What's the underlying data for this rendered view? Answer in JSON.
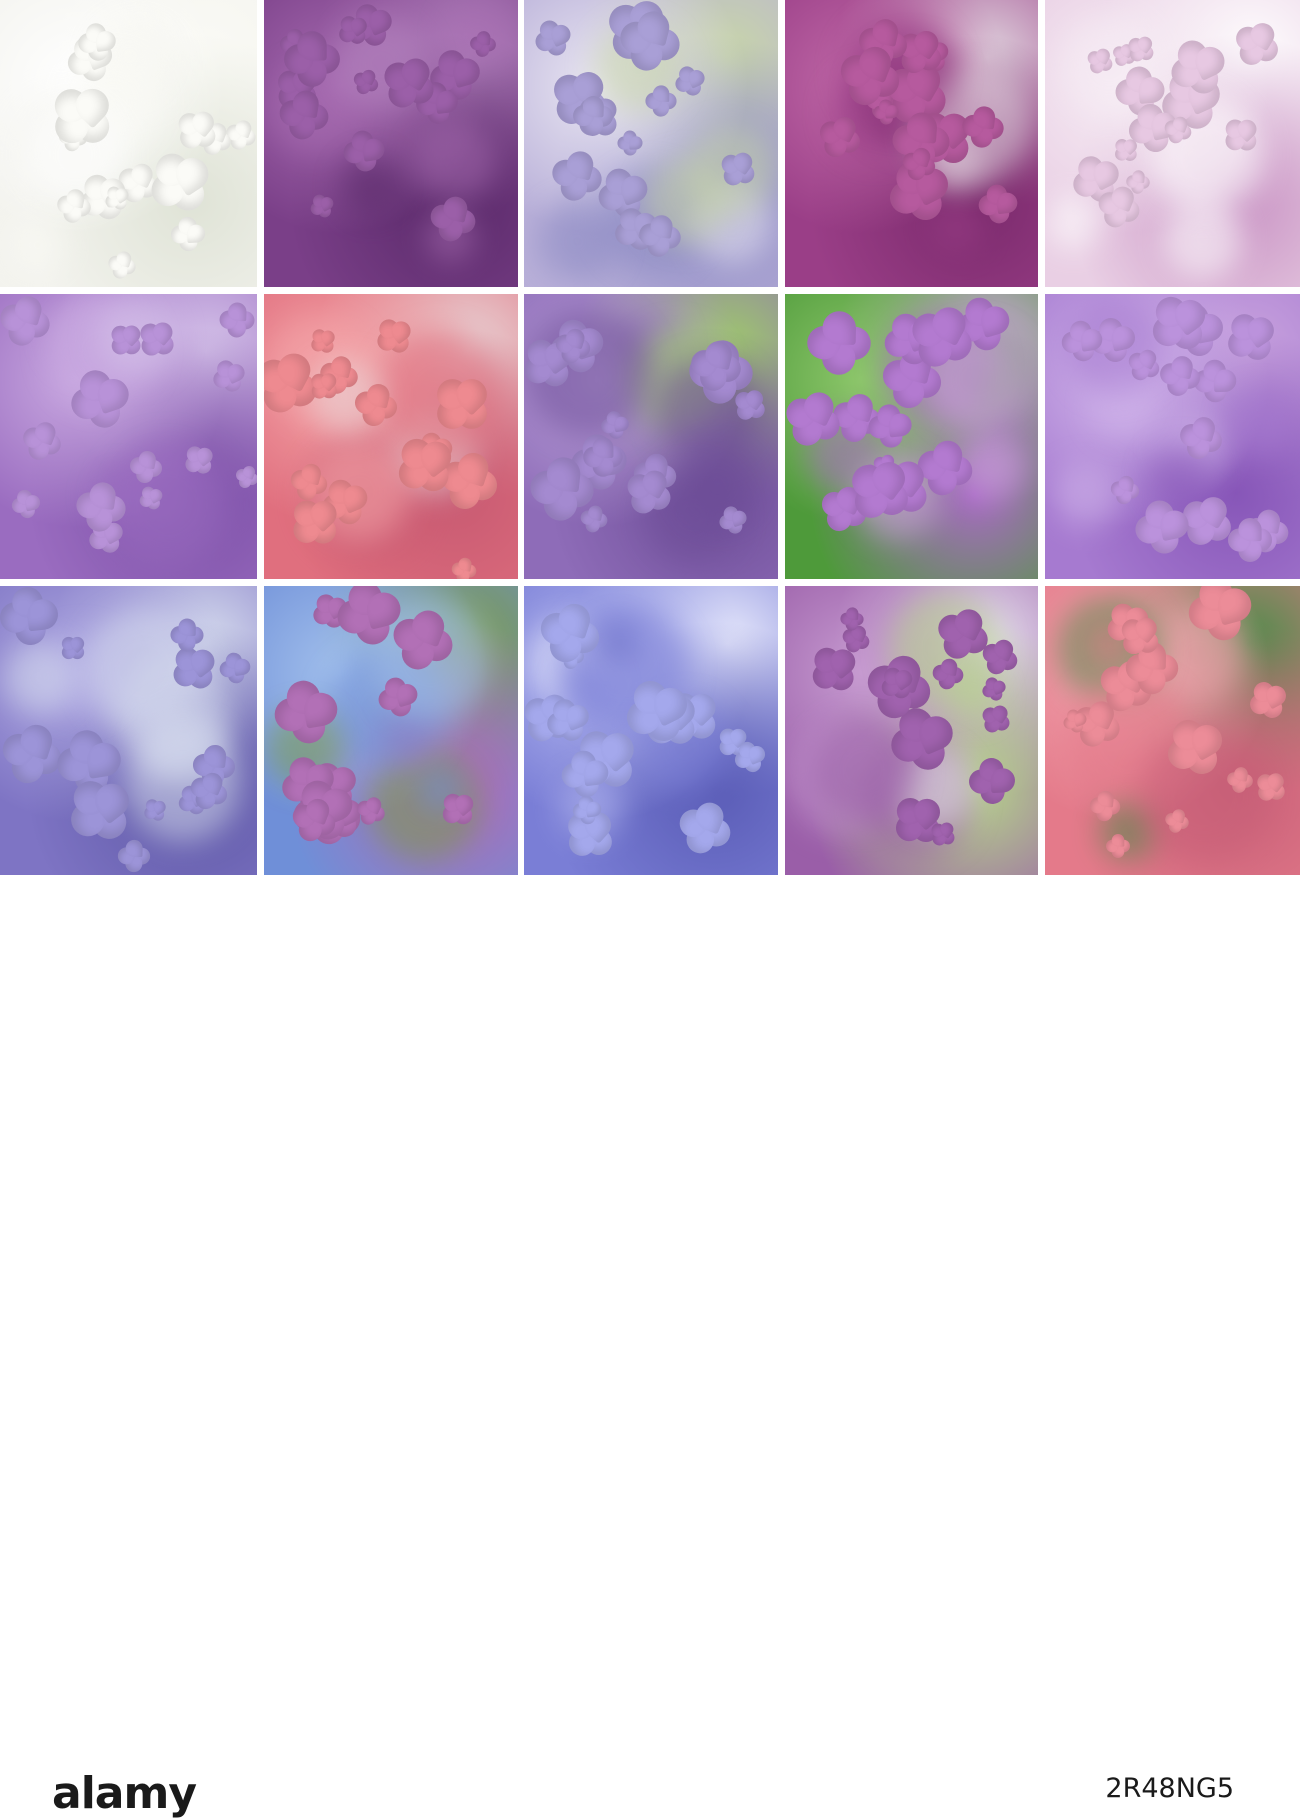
{
  "collage": {
    "tiles": [
      {
        "id": "white-lilac",
        "colors": [
          "#f3f3ee",
          "#ffffff",
          "#dfe3d6",
          "#fafaf5"
        ],
        "petal": "#fbfbf7"
      },
      {
        "id": "purple-lilac-buds",
        "colors": [
          "#7a3f88",
          "#a66bb0",
          "#5a2a6a",
          "#b586c0"
        ],
        "petal": "#9b5fa8"
      },
      {
        "id": "lavender-lilac-sunlight",
        "colors": [
          "#b8afd8",
          "#e9e6f2",
          "#8d8bc4",
          "#c8d6a8"
        ],
        "petal": "#a99fd6"
      },
      {
        "id": "magenta-lilac-cluster",
        "colors": [
          "#9a3e87",
          "#c16aa8",
          "#7a2a6c",
          "#e0d4de"
        ],
        "petal": "#b65a9e"
      },
      {
        "id": "pale-pink-lilac",
        "colors": [
          "#e9cfe4",
          "#f6ecf4",
          "#c994c4",
          "#ffffff"
        ],
        "petal": "#e7c8e2"
      },
      {
        "id": "violet-lilac-closeup",
        "colors": [
          "#9a6cc0",
          "#c8a8e0",
          "#7b4fa6",
          "#d6c4ea"
        ],
        "petal": "#b892d8"
      },
      {
        "id": "coral-pink-lilac",
        "colors": [
          "#e06f7e",
          "#f4a4a8",
          "#c85a72",
          "#e8d6d8"
        ],
        "petal": "#ee8a90"
      },
      {
        "id": "lilac-petals-green-bg",
        "colors": [
          "#8e6cb8",
          "#b9a0d8",
          "#6e4e98",
          "#9fcb6a"
        ],
        "petal": "#a48ad0"
      },
      {
        "id": "lilac-with-leaves",
        "colors": [
          "#4e9a3a",
          "#8cc66a",
          "#a86ac4",
          "#d2a6e2"
        ],
        "petal": "#b37ad0"
      },
      {
        "id": "lilac-macro-violet",
        "colors": [
          "#a67ad0",
          "#d0b4ea",
          "#8756b8",
          "#c8a2de"
        ],
        "petal": "#bb92dc"
      },
      {
        "id": "blue-lilac-branch",
        "colors": [
          "#7e74c4",
          "#b0aae2",
          "#5e58a6",
          "#d6dcee"
        ],
        "petal": "#9c94d8"
      },
      {
        "id": "lilac-blue-sky",
        "colors": [
          "#6f8fd8",
          "#a2c0ec",
          "#b06ab4",
          "#7a9a4a"
        ],
        "petal": "#b270b6"
      },
      {
        "id": "periwinkle-lilac",
        "colors": [
          "#7a7ed6",
          "#b4b8f0",
          "#5a5cb6",
          "#e8eafc"
        ],
        "petal": "#a4a8ec"
      },
      {
        "id": "lilac-garden-bokeh",
        "colors": [
          "#9a5ea8",
          "#c69ad0",
          "#b6d48a",
          "#e6e0ee"
        ],
        "petal": "#a062ae"
      },
      {
        "id": "pink-lilac-green",
        "colors": [
          "#e47a8a",
          "#f2a6b0",
          "#c86078",
          "#4e8c4a"
        ],
        "petal": "#ec8c98"
      }
    ]
  },
  "watermark": {
    "brand": "alamy",
    "image_id": "2R48NG5"
  }
}
